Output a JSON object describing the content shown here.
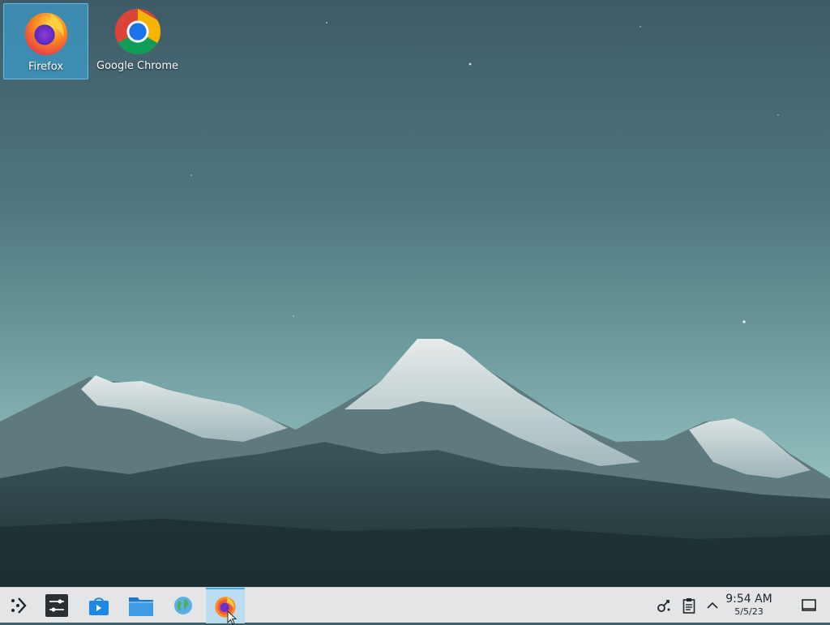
{
  "desktop": {
    "icons": [
      {
        "label": "Firefox",
        "icon": "firefox-icon",
        "selected": true
      },
      {
        "label": "Google Chrome",
        "icon": "chrome-icon",
        "selected": false
      }
    ]
  },
  "taskbar": {
    "launcher_icon": "application-launcher-icon",
    "items": [
      {
        "icon": "system-settings-icon"
      },
      {
        "icon": "discover-store-icon"
      },
      {
        "icon": "dolphin-file-manager-icon"
      },
      {
        "icon": "network-globe-icon"
      },
      {
        "icon": "firefox-icon",
        "active": true
      }
    ],
    "tray": {
      "icons": [
        "network-icon",
        "clipboard-icon",
        "chevron-up-icon"
      ],
      "time": "9:54 AM",
      "date": "5/5/23",
      "show_desktop_icon": "show-desktop-icon"
    }
  },
  "colors": {
    "accent": "#3daee9",
    "taskbar_bg": "#e3e5e7"
  }
}
